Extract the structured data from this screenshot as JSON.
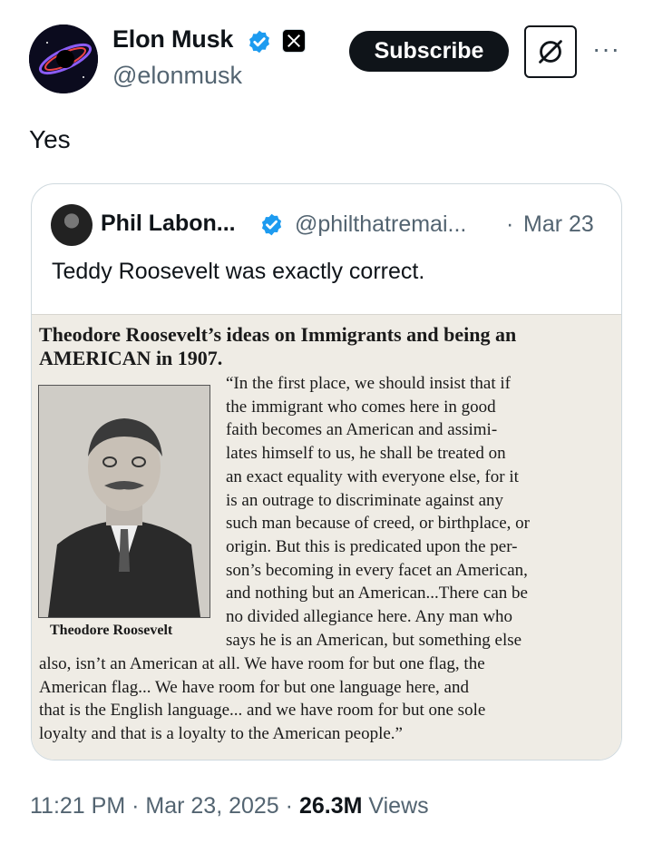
{
  "author": {
    "name": "Elon Musk",
    "handle": "@elonmusk"
  },
  "actions": {
    "subscribe_label": "Subscribe",
    "more_label": "···"
  },
  "post": {
    "text": "Yes"
  },
  "quoted": {
    "name": "Phil Labon...",
    "handle": "@philthatremai...",
    "separator": "·",
    "date": "Mar 23",
    "text": "Teddy Roosevelt was exactly correct.",
    "image": {
      "title": "Theodore Roosevelt’s ideas on Immigrants and being an AMERICAN in 1907.",
      "caption": "Theodore Roosevelt",
      "body_lines_right": [
        "“In the first place, we should insist that if",
        "the immigrant who comes here in good",
        "faith becomes an American and assimi-",
        "lates himself to us, he shall be treated on",
        "an exact equality with everyone else, for it",
        "is an outrage to discriminate against any",
        "such man because of creed, or birthplace, or",
        "origin. But this is predicated upon the per-",
        "son’s becoming in every facet an American,",
        "and nothing but an American...There can be",
        "no divided allegiance here. Any man who",
        "says he is an American, but something else"
      ],
      "body_lines_full": [
        "also, isn’t an American at all. We have room for but one flag, the",
        "American flag... We have room for but one language here, and",
        "that is the English language... and we have room for but one sole",
        "loyalty and that is a loyalty to the American people.”"
      ]
    }
  },
  "meta": {
    "time": "11:21 PM",
    "separator1": "·",
    "date": "Mar 23, 2025",
    "separator2": "·",
    "views_count": "26.3M",
    "views_label": "Views"
  },
  "colors": {
    "verified_blue": "#1d9bf0",
    "text_primary": "#0f1419",
    "text_secondary": "#536471",
    "border": "#cfd9de"
  },
  "icons": [
    "verified-badge-icon",
    "x-logo-icon",
    "grok-icon",
    "more-icon"
  ]
}
